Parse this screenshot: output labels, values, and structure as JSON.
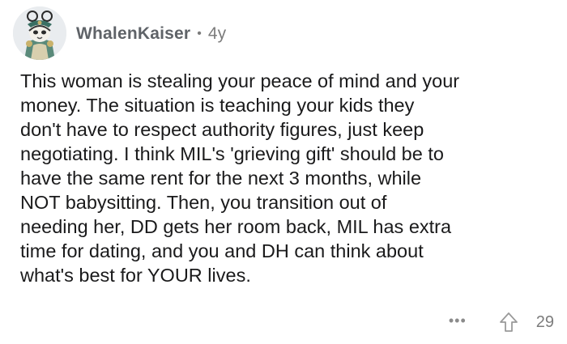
{
  "comment": {
    "author": "WhalenKaiser",
    "separator": "•",
    "age": "4y",
    "text": "This woman is stealing your peace of mind and your\nmoney.  The situation is teaching your kids they\ndon't have to respect authority figures, just keep\nnegotiating.  I think MIL's 'grieving gift' should be to\nhave the same rent for the next 3 months, while\nNOT babysitting.  Then, you transition out of\nneeding her, DD gets her room back, MIL has extra\ntime for dating, and you and DH can think about\nwhat's best for YOUR lives.",
    "more_label": "•••",
    "score": "29"
  },
  "icons": {
    "avatar": "avatar-image",
    "more": "more-options-icon",
    "upvote": "upvote-arrow-icon"
  },
  "colors": {
    "text": "#1a1a1b",
    "meta": "#7c7c7c",
    "background": "#ffffff"
  }
}
